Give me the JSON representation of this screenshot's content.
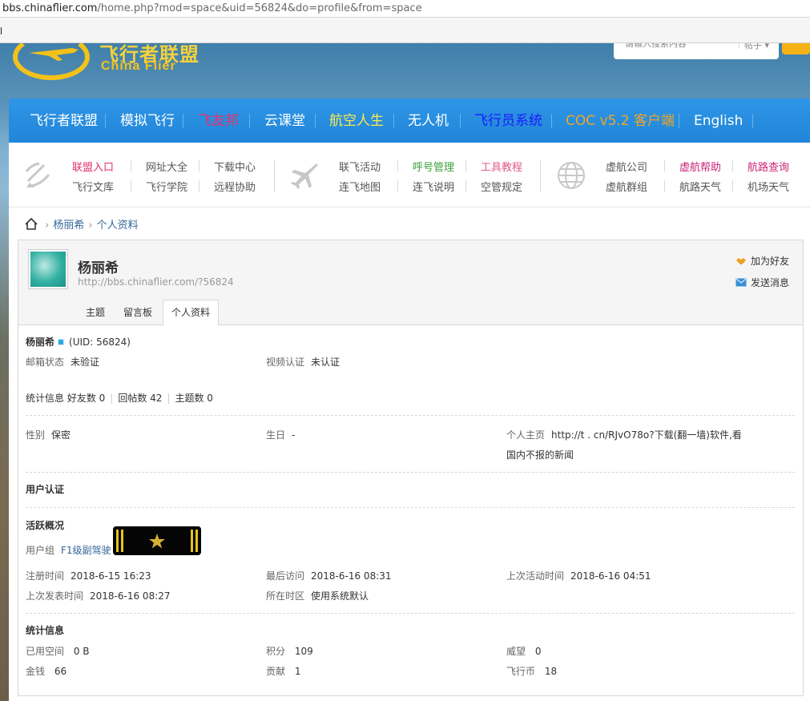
{
  "browser": {
    "url_host": "bbs.chinaflier.com",
    "url_path": "/home.php?mod=space&uid=56824&do=profile&from=space"
  },
  "header": {
    "logo_cn": "飞行者联盟",
    "logo_en": "China Flier",
    "search_placeholder": "请输入搜索内容",
    "search_scope": "帖子"
  },
  "nav": {
    "items": [
      {
        "label": "飞行者联盟",
        "color": "#ffffff"
      },
      {
        "label": "模拟飞行",
        "color": "#ffffff"
      },
      {
        "label": "飞友邦",
        "color": "#e8306b"
      },
      {
        "label": "云课堂",
        "color": "#ffffff"
      },
      {
        "label": "航空人生",
        "color": "#ffe94a"
      },
      {
        "label": "无人机",
        "color": "#ffffff"
      },
      {
        "label": "飞行员系统",
        "color": "#1a1aff"
      },
      {
        "label": "COC v5.2 客户端",
        "color": "#f5a623"
      },
      {
        "label": "English",
        "color": "#ffffff"
      }
    ]
  },
  "quicklinks": {
    "group1": [
      {
        "label": "联盟入口",
        "color": "#e0306b"
      },
      {
        "label": "网址大全",
        "color": "#555555"
      },
      {
        "label": "下载中心",
        "color": "#555555"
      },
      {
        "label": "飞行文库",
        "color": "#555555"
      },
      {
        "label": "飞行学院",
        "color": "#555555"
      },
      {
        "label": "远程协助",
        "color": "#555555"
      }
    ],
    "group2": [
      {
        "label": "联飞活动",
        "color": "#555555"
      },
      {
        "label": "呼号管理",
        "color": "#3aa03a"
      },
      {
        "label": "工具教程",
        "color": "#e05a8a"
      },
      {
        "label": "连飞地图",
        "color": "#555555"
      },
      {
        "label": "连飞说明",
        "color": "#555555"
      },
      {
        "label": "空管规定",
        "color": "#555555"
      }
    ],
    "group3": [
      {
        "label": "虚航公司",
        "color": "#555555"
      },
      {
        "label": "虚航帮助",
        "color": "#cc2277"
      },
      {
        "label": "航路查询",
        "color": "#cc2277"
      },
      {
        "label": "虚航群组",
        "color": "#555555"
      },
      {
        "label": "航路天气",
        "color": "#555555"
      },
      {
        "label": "机场天气",
        "color": "#555555"
      }
    ]
  },
  "breadcrumb": {
    "user": "杨丽希",
    "page": "个人资料"
  },
  "profile": {
    "name": "杨丽希",
    "space_url": "http://bbs.chinaflier.com/?56824",
    "add_friend": "加为好友",
    "send_message": "发送消息",
    "tabs": [
      "主题",
      "留言板",
      "个人资料"
    ],
    "uid": "(UID: 56824)",
    "email_label": "邮箱状态",
    "email_value": "未验证",
    "video_label": "视频认证",
    "video_value": "未认证",
    "stats_label": "统计信息",
    "friends": "好友数 0",
    "replies": "回帖数 42",
    "threads": "主题数 0",
    "gender_label": "性别",
    "gender_value": "保密",
    "birthday_label": "生日",
    "birthday_value": "-",
    "homepage_label": "个人主页",
    "homepage_value_1": "http://t . cn/RJvO78o?下载(翻一墙)软件,看",
    "homepage_value_2": "国内不报的新闻",
    "auth_title": "用户认证",
    "activity_title": "活跃概况",
    "group_label": "用户组",
    "group_value": "F1级副驾驶",
    "reg_label": "注册时间",
    "reg_value": "2018-6-15 16:23",
    "last_visit_label": "最后访问",
    "last_visit_value": "2018-6-16 08:31",
    "last_active_label": "上次活动时间",
    "last_active_value": "2018-6-16 04:51",
    "last_post_label": "上次发表时间",
    "last_post_value": "2018-6-16 08:27",
    "tz_label": "所在时区",
    "tz_value": "使用系统默认",
    "stat_title": "统计信息",
    "space_label": "已用空间",
    "space_value": "0 B",
    "points_label": "积分",
    "points_value": "109",
    "prestige_label": "威望",
    "prestige_value": "0",
    "money_label": "金钱",
    "money_value": "66",
    "contrib_label": "贡献",
    "contrib_value": "1",
    "coin_label": "飞行币",
    "coin_value": "18"
  }
}
